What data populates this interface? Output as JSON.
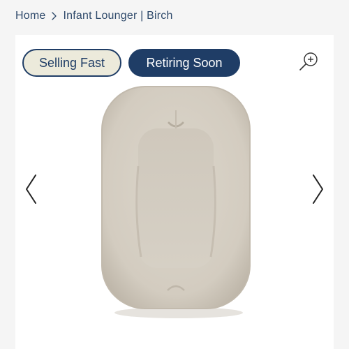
{
  "breadcrumb": {
    "home_label": "Home",
    "separator_icon": "chevron-right-icon",
    "current_label": "Infant Lounger | Birch"
  },
  "badges": {
    "selling_fast": "Selling Fast",
    "retiring_soon": "Retiring Soon"
  },
  "gallery": {
    "zoom_icon": "zoom-in-icon",
    "prev_icon": "chevron-left-icon",
    "next_icon": "chevron-right-icon",
    "product_image": "infant-lounger-birch-image"
  },
  "colors": {
    "navy": "#1f3d66",
    "badge_light": "#eceadb",
    "lounger": "#d9d3c7",
    "text": "#2f4a6b"
  }
}
